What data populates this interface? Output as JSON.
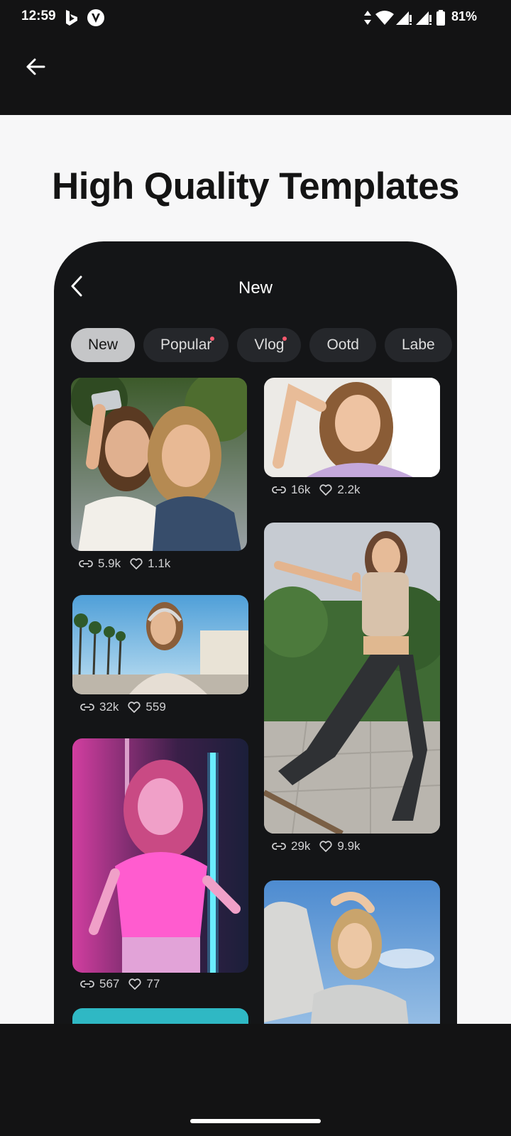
{
  "status": {
    "time": "12:59",
    "battery": "81%",
    "icons": [
      "bing-icon",
      "v-app-icon",
      "data-arrows-icon",
      "wifi-icon",
      "signal-icon",
      "signal-icon",
      "battery-icon"
    ]
  },
  "appbar": {
    "back_icon": "arrow-left-icon"
  },
  "hero": {
    "title": "High Quality Templates"
  },
  "phone": {
    "title": "New",
    "tabs": [
      {
        "label": "New",
        "active": true,
        "dot": false
      },
      {
        "label": "Popular",
        "active": false,
        "dot": true
      },
      {
        "label": "Vlog",
        "active": false,
        "dot": true
      },
      {
        "label": "Ootd",
        "active": false,
        "dot": false
      },
      {
        "label": "Labe",
        "active": false,
        "dot": false
      }
    ],
    "cards": [
      {
        "uses": "5.9k",
        "likes": "1.1k"
      },
      {
        "uses": "16k",
        "likes": "2.2k"
      },
      {
        "uses": "32k",
        "likes": "559"
      },
      {
        "uses": "29k",
        "likes": "9.9k"
      },
      {
        "uses": "567",
        "likes": "77"
      },
      {
        "uses": "",
        "likes": ""
      }
    ]
  },
  "colors": {
    "accent_dot": "#ff5a6e",
    "phone_bg": "#141517",
    "hero_bg": "#f7f7f8"
  }
}
